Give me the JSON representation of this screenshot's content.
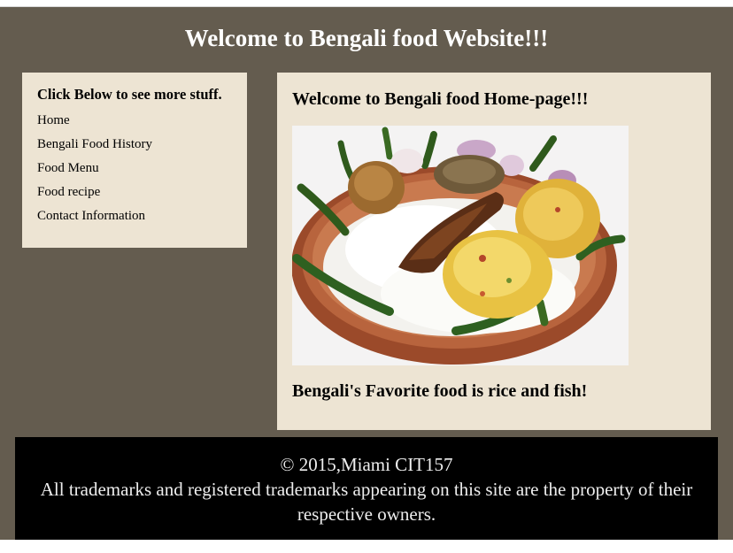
{
  "header": {
    "title": "Welcome to Bengali food Website!!!"
  },
  "sidebar": {
    "heading": "Click Below to see more stuff.",
    "items": [
      {
        "label": "Home"
      },
      {
        "label": "Bengali Food History"
      },
      {
        "label": "Food Menu"
      },
      {
        "label": "Food recipe"
      },
      {
        "label": "Contact Information"
      }
    ]
  },
  "main": {
    "heading": "Welcome to Bengali food Home-page!!!",
    "image_alt": "Plate of rice, fish, and Bengali dishes",
    "caption": "Bengali's Favorite food is rice and fish!"
  },
  "footer": {
    "copyright": "© 2015,Miami CIT157",
    "notice": "All trademarks and registered trademarks appearing on this site are the property of their respective owners."
  },
  "colors": {
    "page_background": "#645c4f",
    "panel_background": "#ede4d3",
    "footer_background": "#000000",
    "title_text": "#ffffff"
  }
}
